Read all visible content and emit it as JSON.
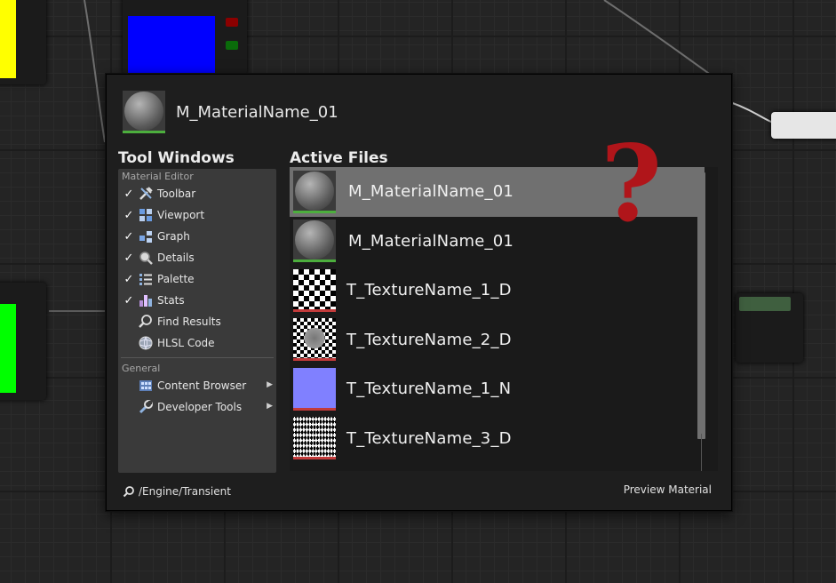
{
  "window": {
    "title": "M_MaterialName_01",
    "tool_windows_heading": "Tool Windows",
    "active_files_heading": "Active Files",
    "footer_path": "/Engine/Transient",
    "footer_action": "Preview Material"
  },
  "tool_groups": [
    {
      "label": "Material Editor",
      "items": [
        {
          "label": "Toolbar",
          "checked": true,
          "icon": "toolbar-icon"
        },
        {
          "label": "Viewport",
          "checked": true,
          "icon": "viewport-icon"
        },
        {
          "label": "Graph",
          "checked": true,
          "icon": "graph-icon"
        },
        {
          "label": "Details",
          "checked": true,
          "icon": "details-icon"
        },
        {
          "label": "Palette",
          "checked": true,
          "icon": "palette-icon"
        },
        {
          "label": "Stats",
          "checked": true,
          "icon": "stats-icon"
        },
        {
          "label": "Find Results",
          "checked": false,
          "icon": "find-results-icon"
        },
        {
          "label": "HLSL Code",
          "checked": false,
          "icon": "hlsl-code-icon"
        }
      ]
    },
    {
      "label": "General",
      "items": [
        {
          "label": "Content Browser",
          "has_submenu": true,
          "icon": "content-browser-icon"
        },
        {
          "label": "Developer Tools",
          "has_submenu": true,
          "icon": "developer-tools-icon"
        }
      ]
    }
  ],
  "active_files": [
    {
      "name": "M_MaterialName_01",
      "thumb": "material-sphere",
      "bar_color": "#4cae3d",
      "selected": true
    },
    {
      "name": "M_MaterialName_01",
      "thumb": "material-sphere",
      "bar_color": "#4cae3d",
      "selected": false
    },
    {
      "name": "T_TextureName_1_D",
      "thumb": "checker",
      "bar_color": "#c23b3b",
      "selected": false
    },
    {
      "name": "T_TextureName_2_D",
      "thumb": "checker-warped",
      "bar_color": "#c23b3b",
      "selected": false
    },
    {
      "name": "T_TextureName_1_N",
      "thumb": "normal-map",
      "bar_color": "#c23b3b",
      "selected": false
    },
    {
      "name": "T_TextureName_3_D",
      "thumb": "wavy-checker",
      "bar_color": "#c23b3b",
      "selected": false
    }
  ],
  "overlay": {
    "symbol": "?",
    "color": "#b0151a"
  },
  "colors": {
    "material_bar": "#4cae3d",
    "texture_bar": "#c23b3b",
    "selected_row": "#707070",
    "panel": "#3a3a3a"
  }
}
